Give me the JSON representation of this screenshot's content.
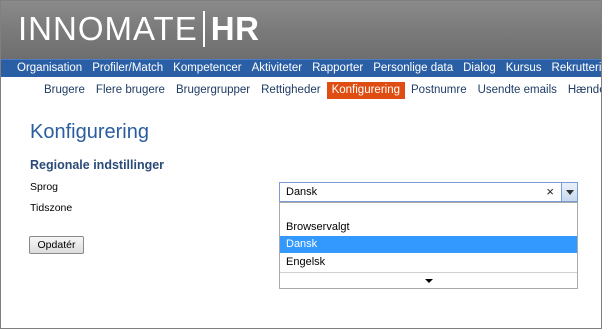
{
  "header": {
    "logo_main": "INNOMATE",
    "logo_sub": "HR"
  },
  "main_nav": {
    "items": [
      {
        "label": "Organisation"
      },
      {
        "label": "Profiler/Match"
      },
      {
        "label": "Kompetencer"
      },
      {
        "label": "Aktiviteter"
      },
      {
        "label": "Rapporter"
      },
      {
        "label": "Personlige data"
      },
      {
        "label": "Dialog"
      },
      {
        "label": "Kursus"
      },
      {
        "label": "Rekruttering"
      }
    ]
  },
  "sub_nav": {
    "items": [
      {
        "label": "Brugere"
      },
      {
        "label": "Flere brugere"
      },
      {
        "label": "Brugergrupper"
      },
      {
        "label": "Rettigheder"
      },
      {
        "label": "Konfigurering",
        "active": true
      },
      {
        "label": "Postnumre"
      },
      {
        "label": "Usendte emails"
      },
      {
        "label": "Hændelser"
      }
    ]
  },
  "page": {
    "title": "Konfigurering",
    "section_title": "Regionale indstillinger",
    "language_label": "Sprog",
    "timezone_label": "Tidszone",
    "update_button": "Opdatér"
  },
  "language_select": {
    "value": "Dansk",
    "clear_glyph": "×",
    "options": [
      {
        "label": "Browservalgt",
        "selected": false
      },
      {
        "label": "Dansk",
        "selected": true
      },
      {
        "label": "Engelsk",
        "selected": false
      }
    ]
  },
  "colors": {
    "header_bg": "#7c7c7c",
    "main_nav_bg": "#2b5fa5",
    "active_tab_bg": "#e04d12",
    "title_color": "#2a5da0",
    "selected_option_bg": "#3399ff"
  }
}
